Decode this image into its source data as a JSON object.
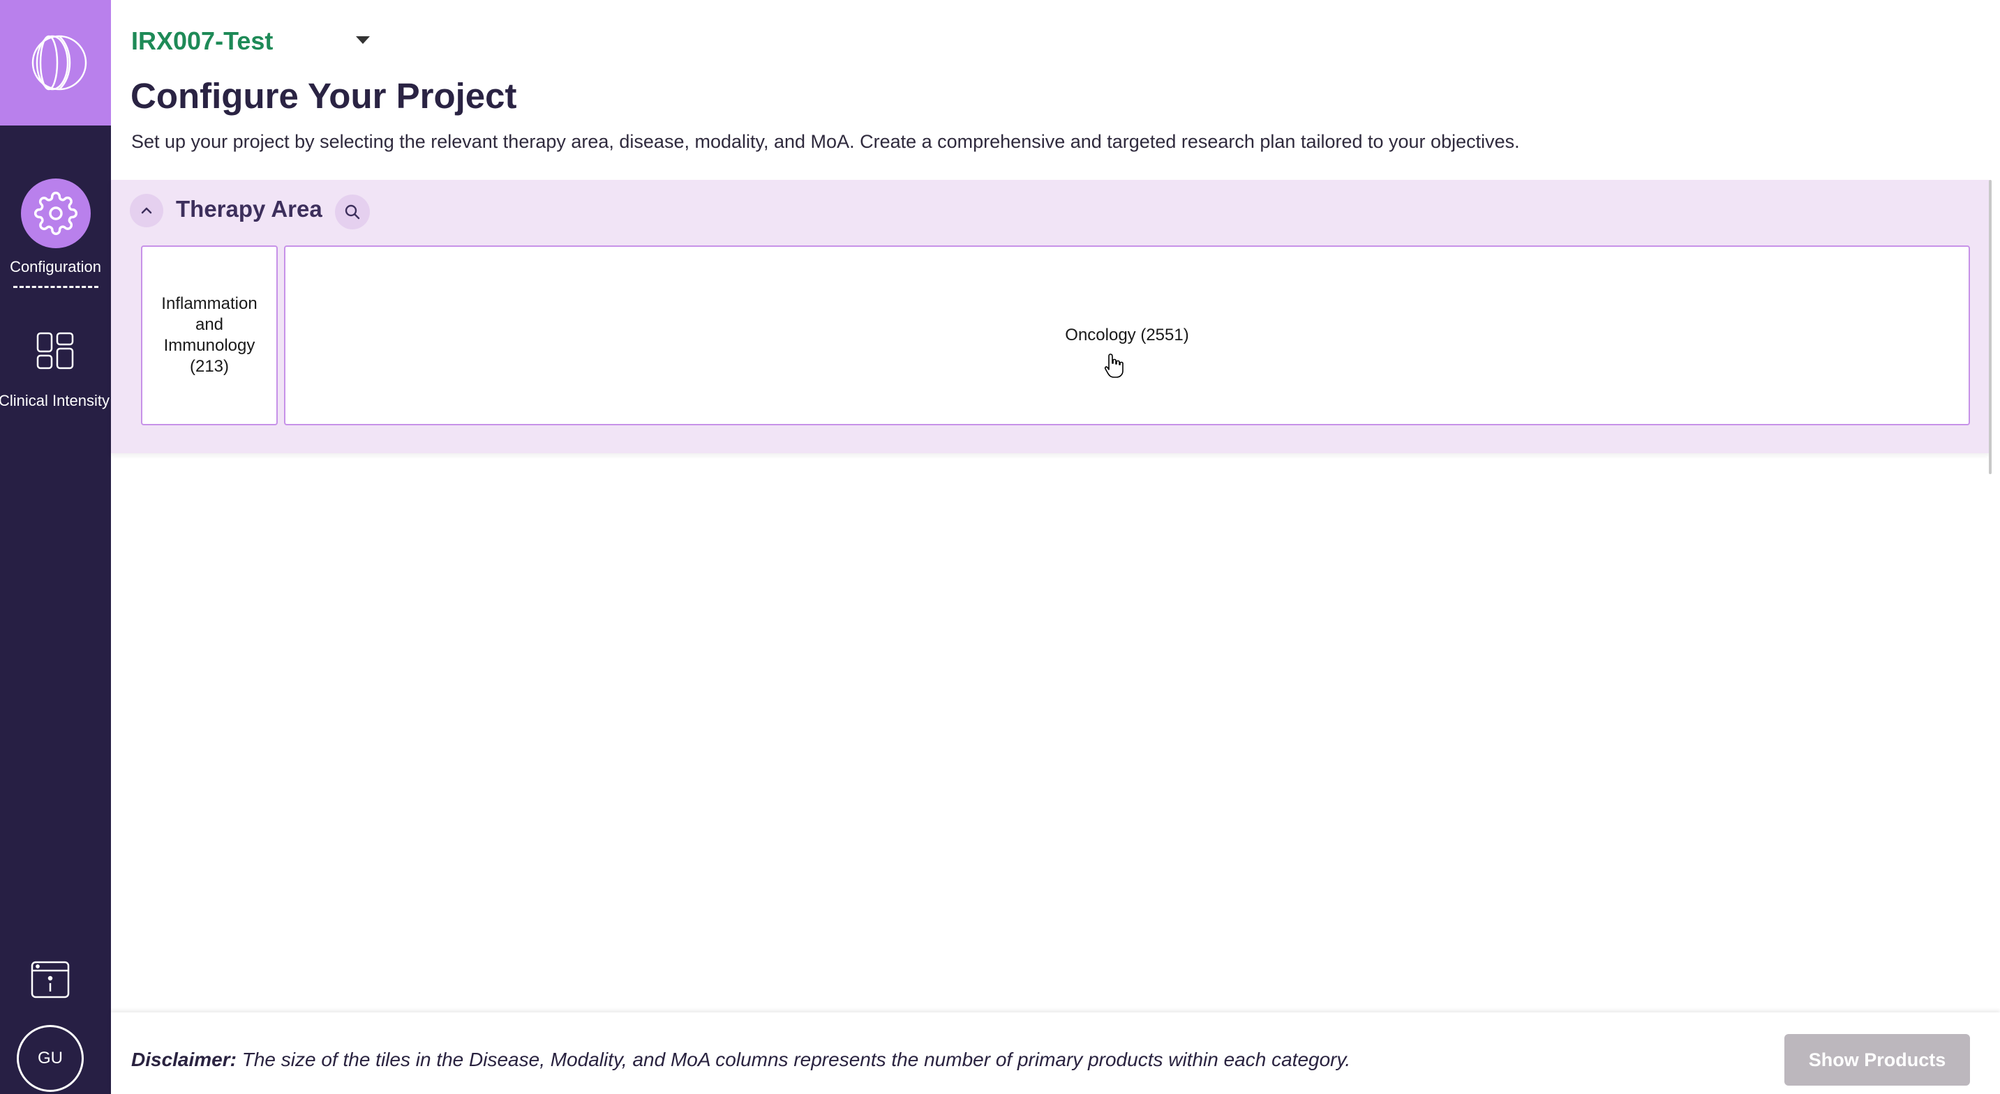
{
  "sidebar": {
    "items": [
      {
        "label": "Configuration",
        "icon": "gear-icon",
        "active": true
      },
      {
        "label": "Clinical Intensity",
        "icon": "dashboard-icon",
        "active": false
      }
    ],
    "info_icon": "info-window-icon",
    "avatar_initials": "GU"
  },
  "header": {
    "project_name": "IRX007-Test",
    "title": "Configure Your Project",
    "subtitle": "Set up your project by selecting the relevant therapy area, disease, modality, and MoA. Create a comprehensive and targeted research plan tailored to your objectives."
  },
  "therapy_area": {
    "title": "Therapy Area",
    "tiles": [
      {
        "label": "Inflammation and Immunology (213)",
        "count": 213
      },
      {
        "label": "Oncology (2551)",
        "count": 2551
      }
    ]
  },
  "footer": {
    "disclaimer_label": "Disclaimer:",
    "disclaimer_text": " The size of the tiles in the Disease, Modality, and MoA columns represents the number of primary products within each category.",
    "show_products_label": "Show Products"
  },
  "colors": {
    "sidebar_bg": "#271f44",
    "accent": "#b980ec",
    "project_name": "#1e8a57",
    "panel_bg": "#f1e4f6",
    "tile_border": "#c792e8",
    "button_disabled": "#bcb7bd"
  }
}
